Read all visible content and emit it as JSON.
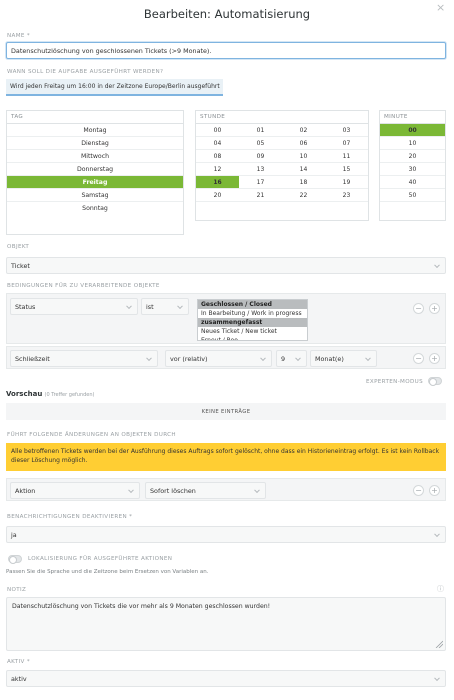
{
  "dialog": {
    "title": "Bearbeiten: Automatisierung",
    "close_glyph": "×"
  },
  "name": {
    "label": "NAME *",
    "value": "Datenschutzlöschung von geschlossenen Tickets (>9 Monate)."
  },
  "schedule": {
    "label": "WANN SOLL DIE AUFGABE AUSGEFÜHRT WERDEN?",
    "summary": "Wird jeden Freitag um 16:00 in der Zeitzone Europe/Berlin ausgeführt",
    "day_header": "TAG",
    "hour_header": "STUNDE",
    "minute_header": "MINUTE",
    "days": [
      "Montag",
      "Dienstag",
      "Mittwoch",
      "Donnerstag",
      "Freitag",
      "Samstag",
      "Sonntag"
    ],
    "selected_day": "Freitag",
    "hours": [
      "00",
      "01",
      "02",
      "03",
      "04",
      "05",
      "06",
      "07",
      "08",
      "09",
      "10",
      "11",
      "12",
      "13",
      "14",
      "15",
      "16",
      "17",
      "18",
      "19",
      "20",
      "21",
      "22",
      "23"
    ],
    "selected_hour": "16",
    "minutes": [
      "00",
      "10",
      "20",
      "30",
      "40",
      "50"
    ],
    "selected_minute": "00"
  },
  "object": {
    "label": "OBJEKT",
    "value": "Ticket"
  },
  "conditions": {
    "label": "BEDINGUNGEN FÜR ZU VERARBEITENDE OBJEKTE",
    "row1": {
      "attribute": "Status",
      "operator": "ist",
      "options": [
        "Geschlossen / Closed",
        "In Bearbeitung / Work in progress",
        "zusammengefasst",
        "Neues Ticket / New ticket",
        "Erneut / Reo…"
      ],
      "highlighted": [
        "Geschlossen / Closed",
        "zusammengefasst"
      ]
    },
    "row2": {
      "attribute": "Schließzeit",
      "operator": "vor (relativ)",
      "amount": "9",
      "unit": "Monat(e)"
    },
    "minus": "−",
    "plus": "+"
  },
  "expert_mode": {
    "label": "EXPERTEN-MODUS",
    "enabled": false
  },
  "preview": {
    "title": "Vorschau",
    "hits": "(0 Treffer gefunden)",
    "empty": "KEINE EINTRÄGE"
  },
  "changes": {
    "label": "FÜHRT FOLGENDE ÄNDERUNGEN AN OBJEKTEN DURCH",
    "warning": "Alle betroffenen Tickets werden bei der Ausführung dieses Auftrags sofort gelöscht, ohne dass ein Historieneintrag erfolgt. Es ist kein Rollback dieser Löschung möglich.",
    "attribute": "Aktion",
    "value": "Sofort löschen",
    "minus": "−",
    "plus": "+"
  },
  "notifications": {
    "label": "BENACHRICHTIGUNGEN DEAKTIVIEREN *",
    "value": "ja"
  },
  "localization": {
    "label": "LOKALISIERUNG FÜR AUSGEFÜHRTE AKTIONEN",
    "enabled": false,
    "help": "Passen Sie die Sprache und die Zeitzone beim Ersetzen von Variablen an."
  },
  "note": {
    "label": "NOTIZ",
    "info_glyph": "ⓘ",
    "value": "Datenschutzlöschung von Tickets die vor mehr als 9 Monaten geschlossen wurden!"
  },
  "active": {
    "label": "AKTIV *",
    "value": "aktiv"
  },
  "colors": {
    "accent_green": "#7bb836",
    "warning_yellow": "#ffce33",
    "name_border_blue": "#7fb4e0"
  }
}
